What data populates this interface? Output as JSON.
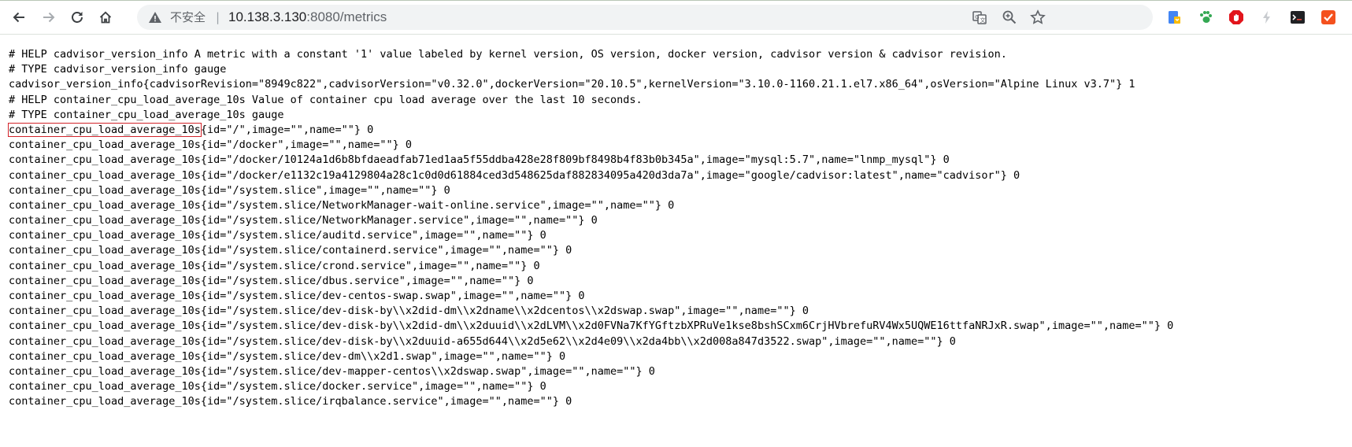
{
  "browser": {
    "insecure_label": "不安全",
    "url_host": "10.138.3.130",
    "url_rest": ":8080/metrics",
    "colors": {
      "accent": "#1a73e8",
      "highlight_box": "#d2232a"
    },
    "icons": [
      "back-arrow-icon",
      "forward-arrow-icon",
      "reload-icon",
      "home-icon",
      "warning-icon",
      "translate-icon",
      "zoom-icon",
      "bookmark-star-icon",
      "extension-save-icon",
      "extension-paw-icon",
      "extension-adblock-icon",
      "extension-lightning-icon",
      "extension-terminal-icon",
      "extension-checkmark-icon"
    ]
  },
  "metrics": {
    "highlighted_metric": "container_cpu_load_average_10s",
    "highlighted_rest": "{id=\"/\",image=\"\",name=\"\"} 0",
    "lines_before": [
      "# HELP cadvisor_version_info A metric with a constant '1' value labeled by kernel version, OS version, docker version, cadvisor version & cadvisor revision.",
      "# TYPE cadvisor_version_info gauge",
      "cadvisor_version_info{cadvisorRevision=\"8949c822\",cadvisorVersion=\"v0.32.0\",dockerVersion=\"20.10.5\",kernelVersion=\"3.10.0-1160.21.1.el7.x86_64\",osVersion=\"Alpine Linux v3.7\"} 1",
      "# HELP container_cpu_load_average_10s Value of container cpu load average over the last 10 seconds.",
      "# TYPE container_cpu_load_average_10s gauge"
    ],
    "lines_after": [
      "container_cpu_load_average_10s{id=\"/docker\",image=\"\",name=\"\"} 0",
      "container_cpu_load_average_10s{id=\"/docker/10124a1d6b8bfdaeadfab71ed1aa5f55ddba428e28f809bf8498b4f83b0b345a\",image=\"mysql:5.7\",name=\"lnmp_mysql\"} 0",
      "container_cpu_load_average_10s{id=\"/docker/e1132c19a4129804a28c1c0d0d61884ced3d548625daf882834095a420d3da7a\",image=\"google/cadvisor:latest\",name=\"cadvisor\"} 0",
      "container_cpu_load_average_10s{id=\"/system.slice\",image=\"\",name=\"\"} 0",
      "container_cpu_load_average_10s{id=\"/system.slice/NetworkManager-wait-online.service\",image=\"\",name=\"\"} 0",
      "container_cpu_load_average_10s{id=\"/system.slice/NetworkManager.service\",image=\"\",name=\"\"} 0",
      "container_cpu_load_average_10s{id=\"/system.slice/auditd.service\",image=\"\",name=\"\"} 0",
      "container_cpu_load_average_10s{id=\"/system.slice/containerd.service\",image=\"\",name=\"\"} 0",
      "container_cpu_load_average_10s{id=\"/system.slice/crond.service\",image=\"\",name=\"\"} 0",
      "container_cpu_load_average_10s{id=\"/system.slice/dbus.service\",image=\"\",name=\"\"} 0",
      "container_cpu_load_average_10s{id=\"/system.slice/dev-centos-swap.swap\",image=\"\",name=\"\"} 0",
      "container_cpu_load_average_10s{id=\"/system.slice/dev-disk-by\\\\x2did-dm\\\\x2dname\\\\x2dcentos\\\\x2dswap.swap\",image=\"\",name=\"\"} 0",
      "container_cpu_load_average_10s{id=\"/system.slice/dev-disk-by\\\\x2did-dm\\\\x2duuid\\\\x2dLVM\\\\x2d0FVNa7KfYGftzbXPRuVe1kse8bshSCxm6CrjHVbrefuRV4Wx5UQWE16ttfaNRJxR.swap\",image=\"\",name=\"\"} 0",
      "container_cpu_load_average_10s{id=\"/system.slice/dev-disk-by\\\\x2duuid-a655d644\\\\x2d5e62\\\\x2d4e09\\\\x2da4bb\\\\x2d008a847d3522.swap\",image=\"\",name=\"\"} 0",
      "container_cpu_load_average_10s{id=\"/system.slice/dev-dm\\\\x2d1.swap\",image=\"\",name=\"\"} 0",
      "container_cpu_load_average_10s{id=\"/system.slice/dev-mapper-centos\\\\x2dswap.swap\",image=\"\",name=\"\"} 0",
      "container_cpu_load_average_10s{id=\"/system.slice/docker.service\",image=\"\",name=\"\"} 0",
      "container_cpu_load_average_10s{id=\"/system.slice/irqbalance.service\",image=\"\",name=\"\"} 0"
    ]
  }
}
